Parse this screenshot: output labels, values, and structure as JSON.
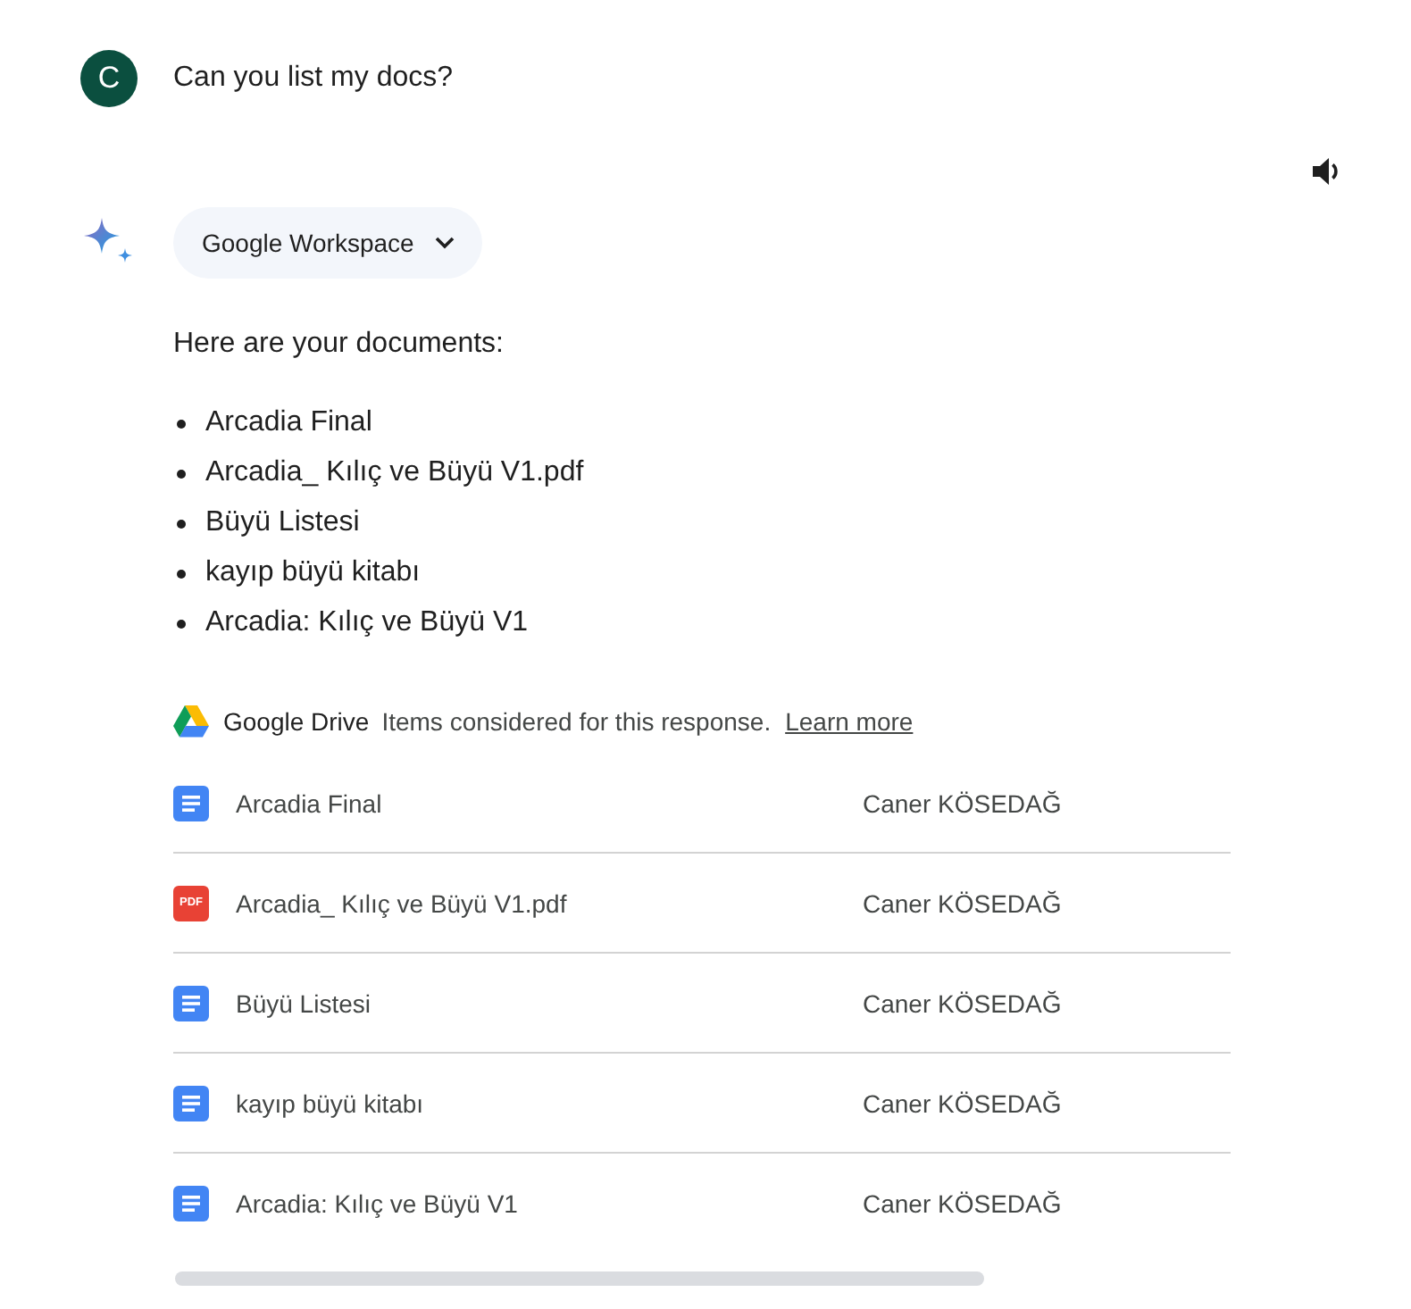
{
  "user_message": {
    "avatar_letter": "C",
    "text": "Can you list my docs?"
  },
  "response": {
    "source_chip": {
      "label": "Google Workspace"
    },
    "intro": "Here are your documents:",
    "bullets": [
      "Arcadia Final",
      "Arcadia_ Kılıç ve Büyü V1.pdf",
      "Büyü Listesi",
      "kayıp büyü kitabı",
      "Arcadia: Kılıç ve Büyü V1"
    ],
    "sources": {
      "service": "Google Drive",
      "note": "Items considered for this response.",
      "link": "Learn more",
      "files": [
        {
          "kind": "doc",
          "name": "Arcadia Final",
          "owner": "Caner KÖSEDAĞ"
        },
        {
          "kind": "pdf",
          "type_label": "PDF",
          "name": "Arcadia_ Kılıç ve Büyü V1.pdf",
          "owner": "Caner KÖSEDAĞ"
        },
        {
          "kind": "doc",
          "name": "Büyü Listesi",
          "owner": "Caner KÖSEDAĞ"
        },
        {
          "kind": "doc",
          "name": "kayıp büyü kitabı",
          "owner": "Caner KÖSEDAĞ"
        },
        {
          "kind": "doc",
          "name": "Arcadia: Kılıç ve Büyü V1",
          "owner": "Caner KÖSEDAĞ"
        }
      ]
    }
  }
}
